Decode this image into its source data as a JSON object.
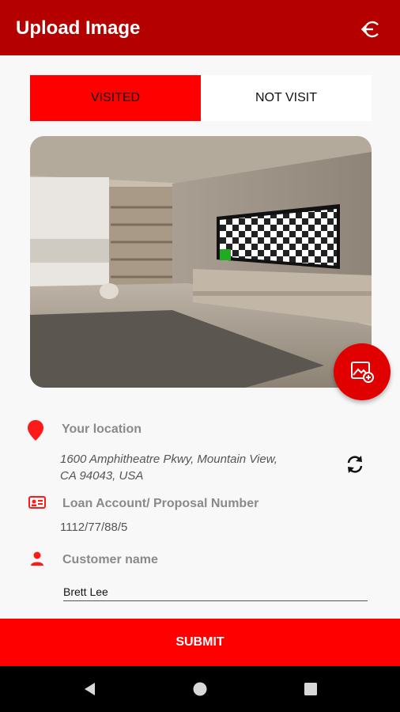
{
  "app": {
    "title": "Upload Image",
    "brand_color": "#b50000",
    "accent_color": "#ff0000"
  },
  "visit_toggle": {
    "options": [
      "VISITED",
      "NOT VISIT"
    ],
    "selected": "VISITED"
  },
  "photo": {
    "scene": "room-with-tv",
    "add_photo_icon": "add-photo-icon"
  },
  "location": {
    "label": "Your location",
    "address": "1600 Amphitheatre Pkwy, Mountain View, CA 94043, USA"
  },
  "loan": {
    "label": "Loan Account/ Proposal Number",
    "value": "1112/77/88/5"
  },
  "customer": {
    "label": "Customer name",
    "value": "Brett Lee"
  },
  "actions": {
    "submit_label": "SUBMIT"
  },
  "icons": {
    "logout": "logout-icon",
    "location": "location-pin-icon",
    "loan": "id-card-icon",
    "customer": "person-icon",
    "refresh": "refresh-icon",
    "nav_back": "back-icon",
    "nav_home": "home-icon",
    "nav_recents": "recents-icon"
  }
}
